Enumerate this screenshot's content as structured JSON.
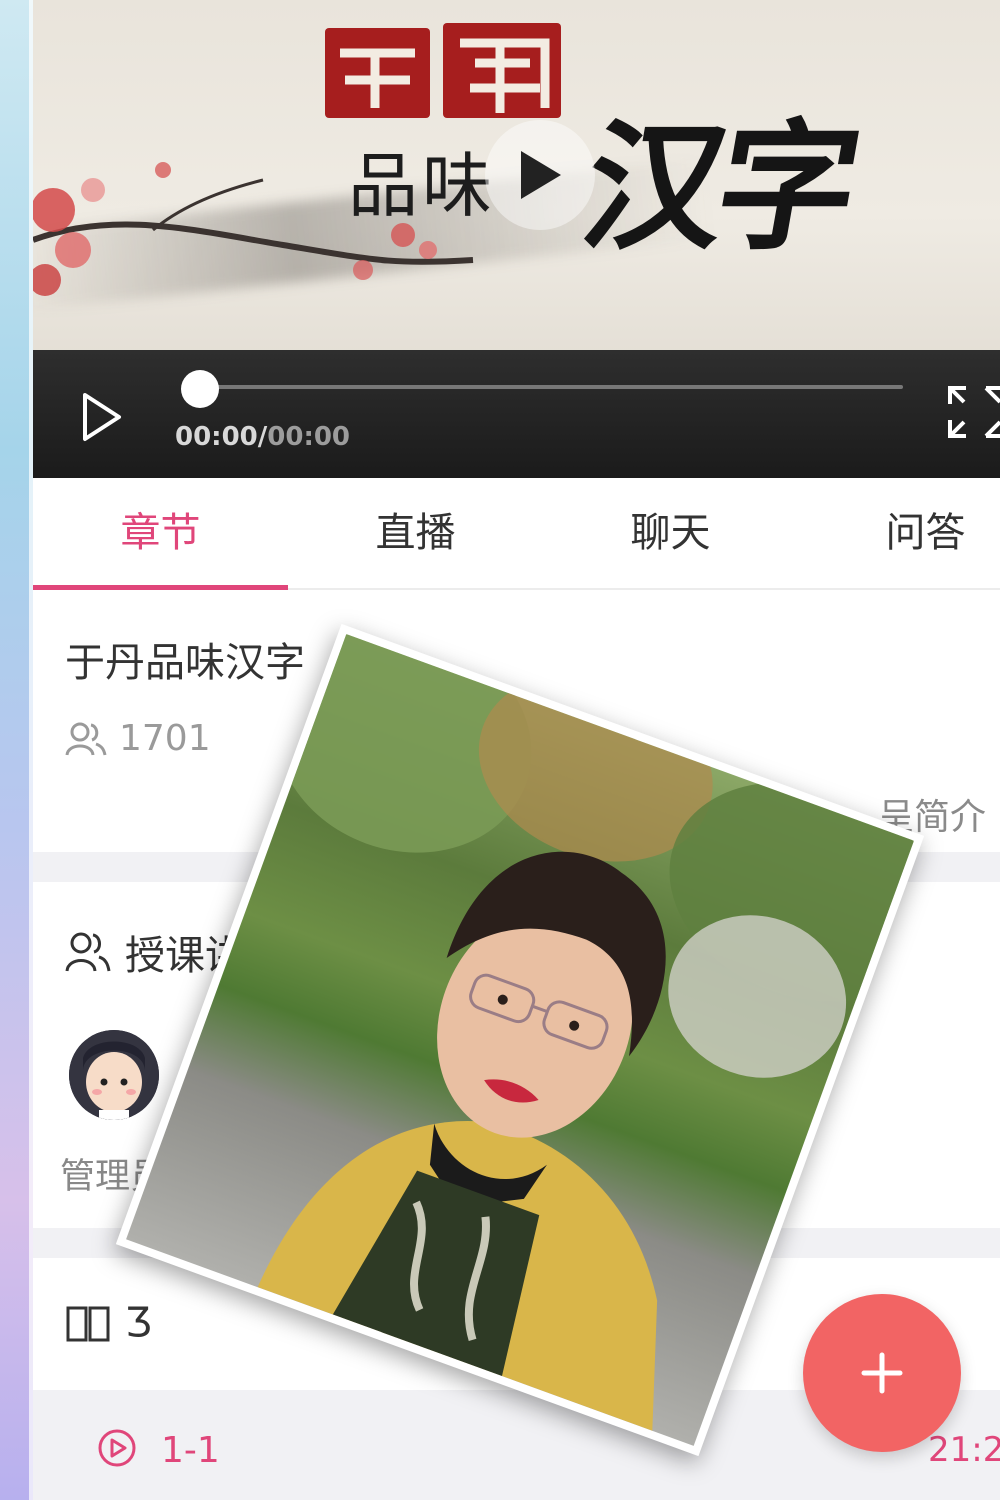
{
  "video": {
    "current_time": "00:00",
    "separator": "/",
    "total_time": "00:00",
    "progress": 0,
    "calligraphy_small": "品味",
    "calligraphy_large": "汉字"
  },
  "tabs": [
    {
      "label": "章节",
      "active": true
    },
    {
      "label": "直播",
      "active": false
    },
    {
      "label": "聊天",
      "active": false
    },
    {
      "label": "问答",
      "active": false
    }
  ],
  "course": {
    "title": "于丹品味汉字",
    "student_count": "1701",
    "intro_link": "呈简介"
  },
  "teachers": {
    "heading": "授课讲",
    "items": [
      {
        "name": "管理员"
      }
    ]
  },
  "catalog": {
    "heading_fragment": "Ӡ",
    "row": {
      "number": "1-1",
      "time": "21:2"
    }
  },
  "colors": {
    "accent": "#e0467a",
    "fab": "#f26464",
    "control_bar": "#1f1f1f"
  },
  "icons": {
    "center_play": "play-icon",
    "control_play": "play-icon",
    "fullscreen": "fullscreen-icon",
    "students": "people-icon",
    "teachers": "people-icon",
    "catalog": "book-icon",
    "chapter_play": "play-circle-icon",
    "fab": "plus-icon"
  }
}
